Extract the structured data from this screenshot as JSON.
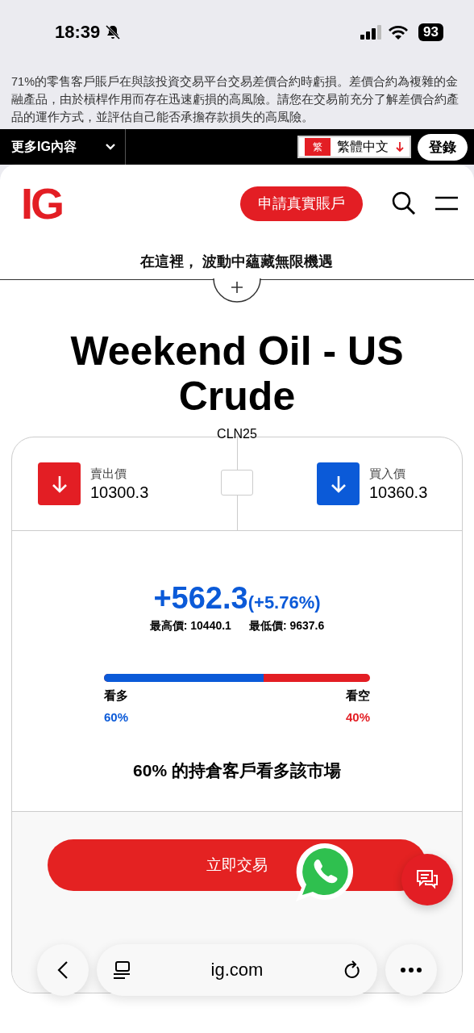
{
  "status_bar": {
    "time": "18:39",
    "battery": "93"
  },
  "disclaimer": "71%的零售客戶賬戶在與該投資交易平台交易差價合約時虧損。差價合約為複雜的金融產品，由於槓桿作用而存在迅速虧損的高風險。請您在交易前充分了解差價合約產品的運作方式，並評估自己能否承擔存款損失的高風險。",
  "top_bar": {
    "menu": "更多IG內容",
    "language_badge": "繁",
    "language": "繁體中文",
    "login": "登錄"
  },
  "header": {
    "logo": "IG",
    "cta": "申請真實賬戶"
  },
  "tagline": "在這裡， 波動中蘊藏無限機遇",
  "market": {
    "title": "Weekend Oil - US Crude",
    "code": "CLN25",
    "quotes": [
      {
        "label": "賣出價",
        "price": "10300.3",
        "color": "#e31e24"
      },
      {
        "label": "買入價",
        "price": "10360.3",
        "color": "#0b5ad8"
      }
    ],
    "change": "+562.3",
    "change_pct": "(+5.76%)",
    "high": "最高價: 10440.1",
    "low": "最低價: 9637.6",
    "sentiment": {
      "level": 0.6,
      "bull_label": "看多",
      "bear_label": "看空",
      "bull_pct": "60%",
      "bear_pct": "40%"
    },
    "summary": "60% 的持倉客戶看多該市場",
    "trade_button": "立即交易"
  },
  "browser": {
    "url": "ig.com"
  }
}
